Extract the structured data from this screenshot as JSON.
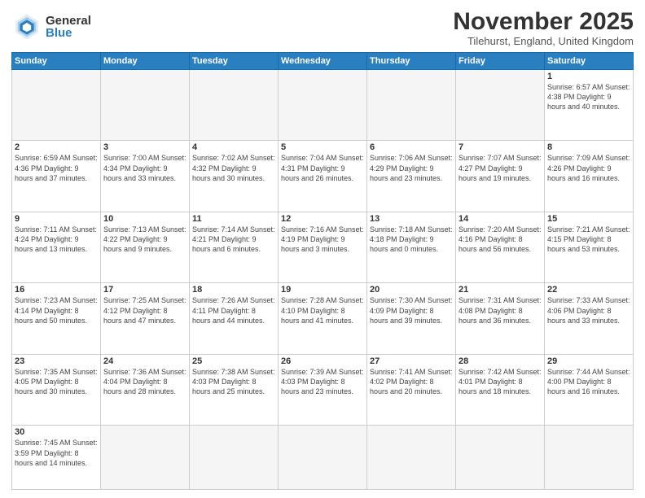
{
  "header": {
    "logo_general": "General",
    "logo_blue": "Blue",
    "month_title": "November 2025",
    "location": "Tilehurst, England, United Kingdom"
  },
  "days_of_week": [
    "Sunday",
    "Monday",
    "Tuesday",
    "Wednesday",
    "Thursday",
    "Friday",
    "Saturday"
  ],
  "weeks": [
    [
      {
        "day": "",
        "info": "",
        "empty": true
      },
      {
        "day": "",
        "info": "",
        "empty": true
      },
      {
        "day": "",
        "info": "",
        "empty": true
      },
      {
        "day": "",
        "info": "",
        "empty": true
      },
      {
        "day": "",
        "info": "",
        "empty": true
      },
      {
        "day": "",
        "info": "",
        "empty": true
      },
      {
        "day": "1",
        "info": "Sunrise: 6:57 AM\nSunset: 4:38 PM\nDaylight: 9 hours\nand 40 minutes."
      }
    ],
    [
      {
        "day": "2",
        "info": "Sunrise: 6:59 AM\nSunset: 4:36 PM\nDaylight: 9 hours\nand 37 minutes."
      },
      {
        "day": "3",
        "info": "Sunrise: 7:00 AM\nSunset: 4:34 PM\nDaylight: 9 hours\nand 33 minutes."
      },
      {
        "day": "4",
        "info": "Sunrise: 7:02 AM\nSunset: 4:32 PM\nDaylight: 9 hours\nand 30 minutes."
      },
      {
        "day": "5",
        "info": "Sunrise: 7:04 AM\nSunset: 4:31 PM\nDaylight: 9 hours\nand 26 minutes."
      },
      {
        "day": "6",
        "info": "Sunrise: 7:06 AM\nSunset: 4:29 PM\nDaylight: 9 hours\nand 23 minutes."
      },
      {
        "day": "7",
        "info": "Sunrise: 7:07 AM\nSunset: 4:27 PM\nDaylight: 9 hours\nand 19 minutes."
      },
      {
        "day": "8",
        "info": "Sunrise: 7:09 AM\nSunset: 4:26 PM\nDaylight: 9 hours\nand 16 minutes."
      }
    ],
    [
      {
        "day": "9",
        "info": "Sunrise: 7:11 AM\nSunset: 4:24 PM\nDaylight: 9 hours\nand 13 minutes."
      },
      {
        "day": "10",
        "info": "Sunrise: 7:13 AM\nSunset: 4:22 PM\nDaylight: 9 hours\nand 9 minutes."
      },
      {
        "day": "11",
        "info": "Sunrise: 7:14 AM\nSunset: 4:21 PM\nDaylight: 9 hours\nand 6 minutes."
      },
      {
        "day": "12",
        "info": "Sunrise: 7:16 AM\nSunset: 4:19 PM\nDaylight: 9 hours\nand 3 minutes."
      },
      {
        "day": "13",
        "info": "Sunrise: 7:18 AM\nSunset: 4:18 PM\nDaylight: 9 hours\nand 0 minutes."
      },
      {
        "day": "14",
        "info": "Sunrise: 7:20 AM\nSunset: 4:16 PM\nDaylight: 8 hours\nand 56 minutes."
      },
      {
        "day": "15",
        "info": "Sunrise: 7:21 AM\nSunset: 4:15 PM\nDaylight: 8 hours\nand 53 minutes."
      }
    ],
    [
      {
        "day": "16",
        "info": "Sunrise: 7:23 AM\nSunset: 4:14 PM\nDaylight: 8 hours\nand 50 minutes."
      },
      {
        "day": "17",
        "info": "Sunrise: 7:25 AM\nSunset: 4:12 PM\nDaylight: 8 hours\nand 47 minutes."
      },
      {
        "day": "18",
        "info": "Sunrise: 7:26 AM\nSunset: 4:11 PM\nDaylight: 8 hours\nand 44 minutes."
      },
      {
        "day": "19",
        "info": "Sunrise: 7:28 AM\nSunset: 4:10 PM\nDaylight: 8 hours\nand 41 minutes."
      },
      {
        "day": "20",
        "info": "Sunrise: 7:30 AM\nSunset: 4:09 PM\nDaylight: 8 hours\nand 39 minutes."
      },
      {
        "day": "21",
        "info": "Sunrise: 7:31 AM\nSunset: 4:08 PM\nDaylight: 8 hours\nand 36 minutes."
      },
      {
        "day": "22",
        "info": "Sunrise: 7:33 AM\nSunset: 4:06 PM\nDaylight: 8 hours\nand 33 minutes."
      }
    ],
    [
      {
        "day": "23",
        "info": "Sunrise: 7:35 AM\nSunset: 4:05 PM\nDaylight: 8 hours\nand 30 minutes."
      },
      {
        "day": "24",
        "info": "Sunrise: 7:36 AM\nSunset: 4:04 PM\nDaylight: 8 hours\nand 28 minutes."
      },
      {
        "day": "25",
        "info": "Sunrise: 7:38 AM\nSunset: 4:03 PM\nDaylight: 8 hours\nand 25 minutes."
      },
      {
        "day": "26",
        "info": "Sunrise: 7:39 AM\nSunset: 4:03 PM\nDaylight: 8 hours\nand 23 minutes."
      },
      {
        "day": "27",
        "info": "Sunrise: 7:41 AM\nSunset: 4:02 PM\nDaylight: 8 hours\nand 20 minutes."
      },
      {
        "day": "28",
        "info": "Sunrise: 7:42 AM\nSunset: 4:01 PM\nDaylight: 8 hours\nand 18 minutes."
      },
      {
        "day": "29",
        "info": "Sunrise: 7:44 AM\nSunset: 4:00 PM\nDaylight: 8 hours\nand 16 minutes."
      }
    ],
    [
      {
        "day": "30",
        "info": "Sunrise: 7:45 AM\nSunset: 3:59 PM\nDaylight: 8 hours\nand 14 minutes.",
        "last": true
      },
      {
        "day": "",
        "info": "",
        "empty": true,
        "last": true
      },
      {
        "day": "",
        "info": "",
        "empty": true,
        "last": true
      },
      {
        "day": "",
        "info": "",
        "empty": true,
        "last": true
      },
      {
        "day": "",
        "info": "",
        "empty": true,
        "last": true
      },
      {
        "day": "",
        "info": "",
        "empty": true,
        "last": true
      },
      {
        "day": "",
        "info": "",
        "empty": true,
        "last": true
      }
    ]
  ]
}
